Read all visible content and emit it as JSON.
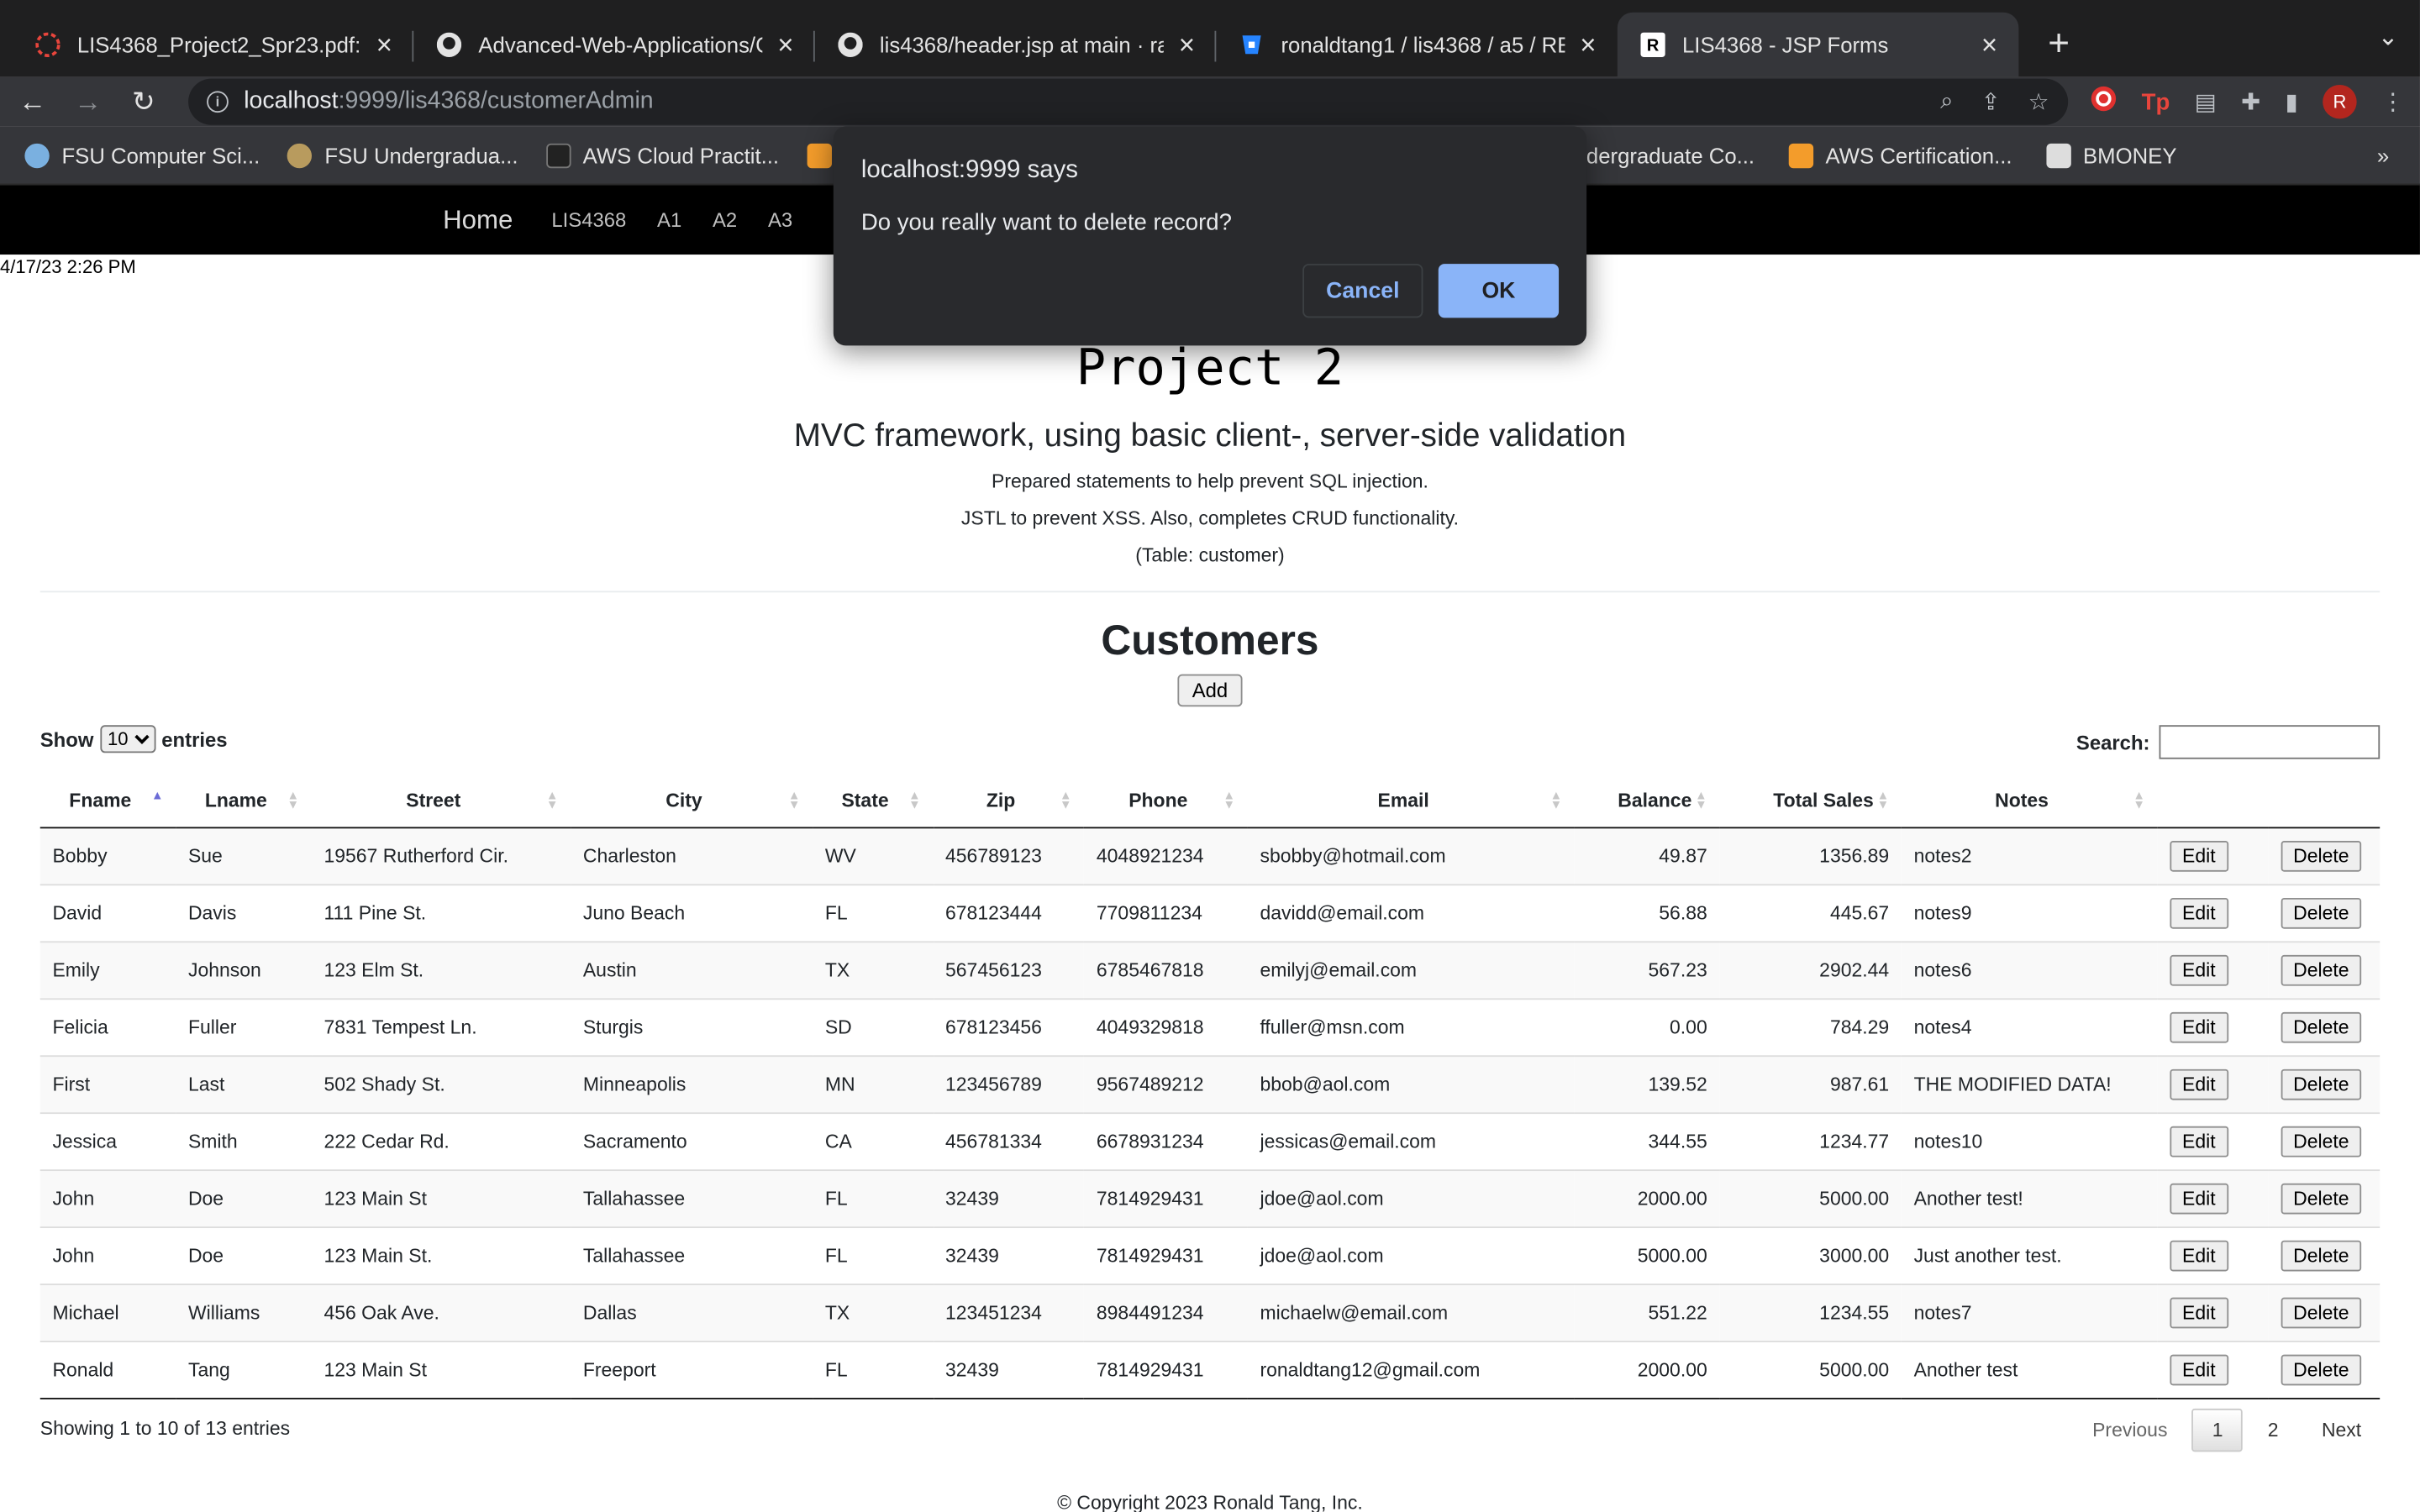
{
  "browser": {
    "tabs": [
      {
        "title": "LIS4368_Project2_Spr23.pdf:",
        "icon": "pdf-icon",
        "active": false
      },
      {
        "title": "Advanced-Web-Applications/C",
        "icon": "github-icon",
        "active": false
      },
      {
        "title": "lis4368/header.jsp at main · ra",
        "icon": "github-icon",
        "active": false
      },
      {
        "title": "ronaldtang1 / lis4368 / a5 / RE/",
        "icon": "bitbucket-icon",
        "active": false
      },
      {
        "title": "LIS4368 - JSP Forms",
        "icon": "r-favicon-icon",
        "active": true
      }
    ],
    "url_host": "localhost",
    "url_path": ":9999/lis4368/customerAdmin",
    "profile_initial": "R",
    "bookmarks_left": [
      "FSU Computer Sci...",
      "FSU Undergradua...",
      "AWS Cloud Practit..."
    ],
    "bookmarks_right": [
      "Undergraduate Co...",
      "AWS Certification...",
      "BMONEY"
    ],
    "bookmarks_more": "»"
  },
  "navbar": {
    "brand": "Home",
    "links": [
      "LIS4368",
      "A1",
      "A2",
      "A3"
    ]
  },
  "datestamp": "4/17/23 2:26 PM",
  "header": {
    "title": "Project 2",
    "subtitle": "MVC framework, using basic client-, server-side validation",
    "lines": [
      "Prepared statements to help prevent SQL injection.",
      "JSTL to prevent XSS. Also, completes CRUD functionality.",
      "(Table: customer)"
    ]
  },
  "customers": {
    "heading": "Customers",
    "add_label": "Add",
    "show_label": "Show",
    "show_value": "10",
    "entries_label": "entries",
    "search_label": "Search:",
    "columns": [
      "Fname",
      "Lname",
      "Street",
      "City",
      "State",
      "Zip",
      "Phone",
      "Email",
      "Balance",
      "Total Sales",
      "Notes"
    ],
    "edit_label": "Edit",
    "delete_label": "Delete",
    "rows": [
      [
        "Bobby",
        "Sue",
        "19567 Rutherford Cir.",
        "Charleston",
        "WV",
        "456789123",
        "4048921234",
        "sbobby@hotmail.com",
        "49.87",
        "1356.89",
        "notes2"
      ],
      [
        "David",
        "Davis",
        "111 Pine St.",
        "Juno Beach",
        "FL",
        "678123444",
        "7709811234",
        "davidd@email.com",
        "56.88",
        "445.67",
        "notes9"
      ],
      [
        "Emily",
        "Johnson",
        "123 Elm St.",
        "Austin",
        "TX",
        "567456123",
        "6785467818",
        "emilyj@email.com",
        "567.23",
        "2902.44",
        "notes6"
      ],
      [
        "Felicia",
        "Fuller",
        "7831 Tempest Ln.",
        "Sturgis",
        "SD",
        "678123456",
        "4049329818",
        "ffuller@msn.com",
        "0.00",
        "784.29",
        "notes4"
      ],
      [
        "First",
        "Last",
        "502 Shady St.",
        "Minneapolis",
        "MN",
        "123456789",
        "9567489212",
        "bbob@aol.com",
        "139.52",
        "987.61",
        "THE MODIFIED DATA!"
      ],
      [
        "Jessica",
        "Smith",
        "222 Cedar Rd.",
        "Sacramento",
        "CA",
        "456781334",
        "6678931234",
        "jessicas@email.com",
        "344.55",
        "1234.77",
        "notes10"
      ],
      [
        "John",
        "Doe",
        "123 Main St",
        "Tallahassee",
        "FL",
        "32439",
        "7814929431",
        "jdoe@aol.com",
        "2000.00",
        "5000.00",
        "Another test!"
      ],
      [
        "John",
        "Doe",
        "123 Main St.",
        "Tallahassee",
        "FL",
        "32439",
        "7814929431",
        "jdoe@aol.com",
        "5000.00",
        "3000.00",
        "Just another test."
      ],
      [
        "Michael",
        "Williams",
        "456 Oak Ave.",
        "Dallas",
        "TX",
        "123451234",
        "8984491234",
        "michaelw@email.com",
        "551.22",
        "1234.55",
        "notes7"
      ],
      [
        "Ronald",
        "Tang",
        "123 Main St",
        "Freeport",
        "FL",
        "32439",
        "7814929431",
        "ronaldtang12@gmail.com",
        "2000.00",
        "5000.00",
        "Another test"
      ]
    ],
    "info": "Showing 1 to 10 of 13 entries",
    "pagination": {
      "previous": "Previous",
      "pages": [
        "1",
        "2"
      ],
      "next": "Next"
    }
  },
  "footer": "© Copyright 2023 Ronald Tang, Inc.",
  "dialog": {
    "title": "localhost:9999 says",
    "message": "Do you really want to delete record?",
    "cancel": "Cancel",
    "ok": "OK"
  }
}
